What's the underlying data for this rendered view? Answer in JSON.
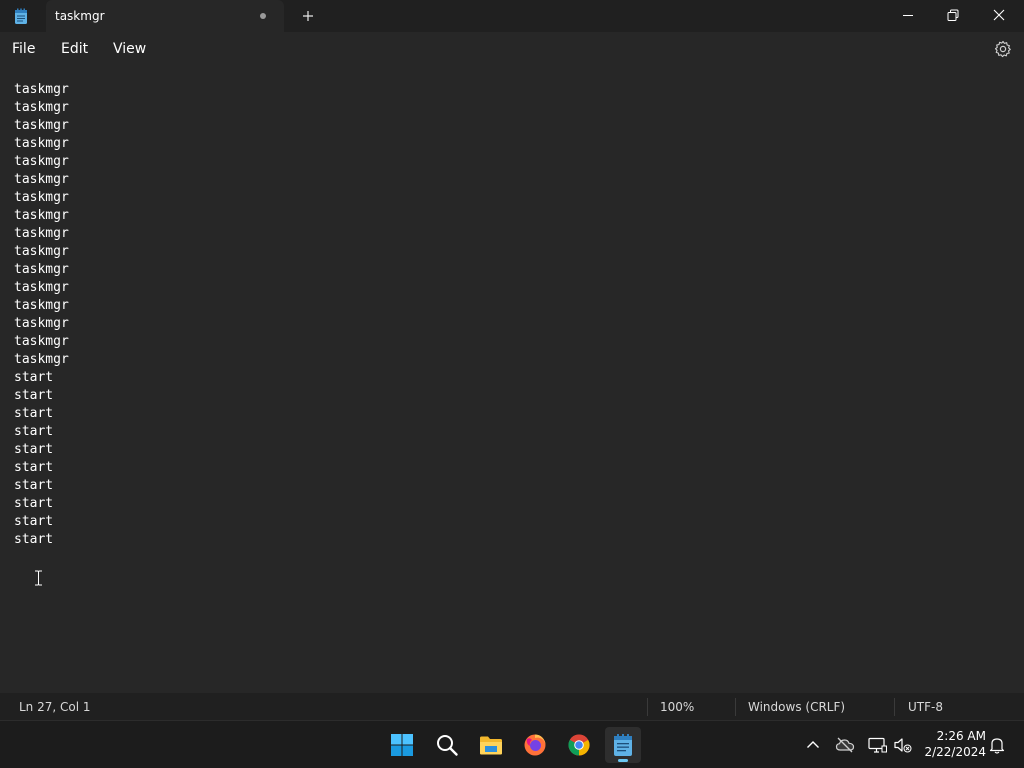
{
  "window": {
    "tab_title": "taskmgr",
    "menu": {
      "file": "File",
      "edit": "Edit",
      "view": "View"
    }
  },
  "editor": {
    "lines": [
      "taskmgr",
      "taskmgr",
      "taskmgr",
      "taskmgr",
      "taskmgr",
      "taskmgr",
      "taskmgr",
      "taskmgr",
      "taskmgr",
      "taskmgr",
      "taskmgr",
      "taskmgr",
      "taskmgr",
      "taskmgr",
      "taskmgr",
      "taskmgr",
      "start",
      "start",
      "start",
      "start",
      "start",
      "start",
      "start",
      "start",
      "start",
      "start"
    ]
  },
  "statusbar": {
    "position": "Ln 27, Col 1",
    "zoom": "100%",
    "line_ending": "Windows (CRLF)",
    "encoding": "UTF-8"
  },
  "taskbar": {
    "apps": [
      "start-icon",
      "search-icon",
      "file-explorer-icon",
      "firefox-icon",
      "chrome-icon",
      "notepad-icon"
    ],
    "active_app": "notepad-icon",
    "clock": {
      "time": "2:26 AM",
      "date": "2/22/2024"
    }
  },
  "colors": {
    "background": "#272727",
    "titlebar": "#202020",
    "accent": "#6bc7f2",
    "text": "#ffffff"
  }
}
